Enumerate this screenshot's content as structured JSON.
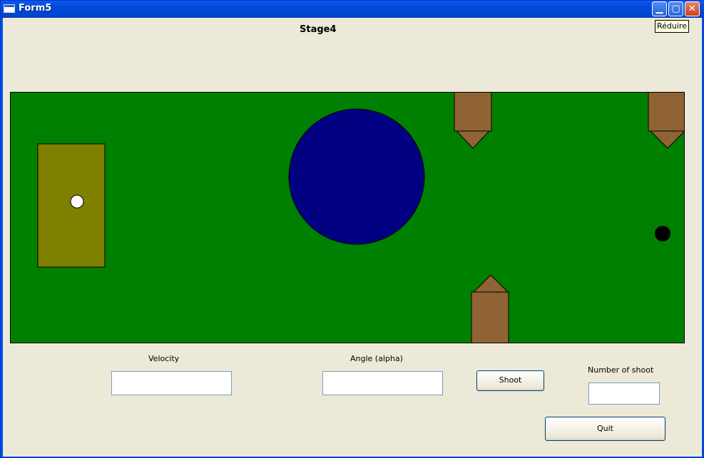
{
  "window": {
    "title": "Form5",
    "minimize_tooltip": "Réduire"
  },
  "stage": {
    "title": "Stage4"
  },
  "colors": {
    "field": "#008000",
    "launch_zone": "#808000",
    "obstacle_circle": "#000080",
    "block": "#8f6333",
    "ball": "#ffffff",
    "target": "#000000"
  },
  "controls": {
    "velocity_label": "Velocity",
    "velocity_value": "",
    "angle_label": "Angle (alpha)",
    "angle_value": "",
    "shoot_label": "Shoot",
    "shots_label": "Number of shoot",
    "shots_value": "",
    "quit_label": "Quit"
  }
}
